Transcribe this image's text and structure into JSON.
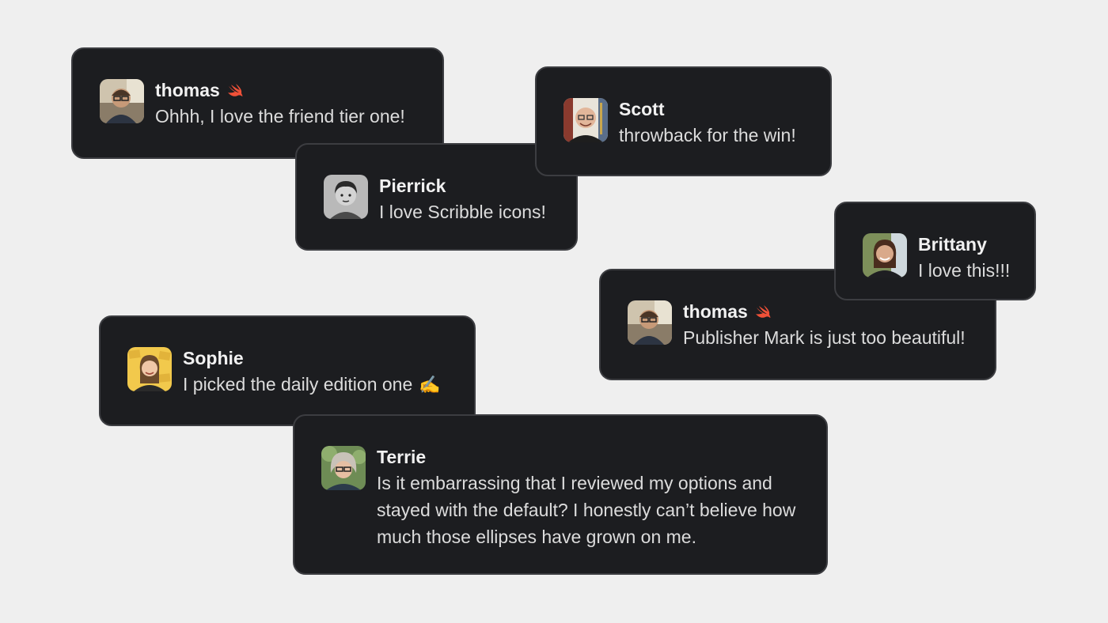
{
  "messages": [
    {
      "name": "thomas",
      "text": "Ohhh, I love the friend tier one!",
      "badge_icon": "swift-icon"
    },
    {
      "name": "Scott",
      "text": "throwback for the win!"
    },
    {
      "name": "Pierrick",
      "text": "I love Scribble icons!"
    },
    {
      "name": "Brittany",
      "text": "I love this!!!"
    },
    {
      "name": "thomas",
      "text": "Publisher Mark is just too beautiful!",
      "badge_icon": "swift-icon"
    },
    {
      "name": "Sophie",
      "text": "I picked the daily edition one",
      "trailing_emoji": "✍️"
    },
    {
      "name": "Terrie",
      "text": "Is it embarrassing that I reviewed my options and stayed with the default? I honestly can’t believe how much those ellipses have grown on me."
    }
  ],
  "colors": {
    "background": "#efefef",
    "card": "#1c1d20",
    "card_border": "#3c3d41",
    "name_text": "#f1f1f1",
    "message_text": "#dcdcdc",
    "swift_accent": "#f05138"
  }
}
